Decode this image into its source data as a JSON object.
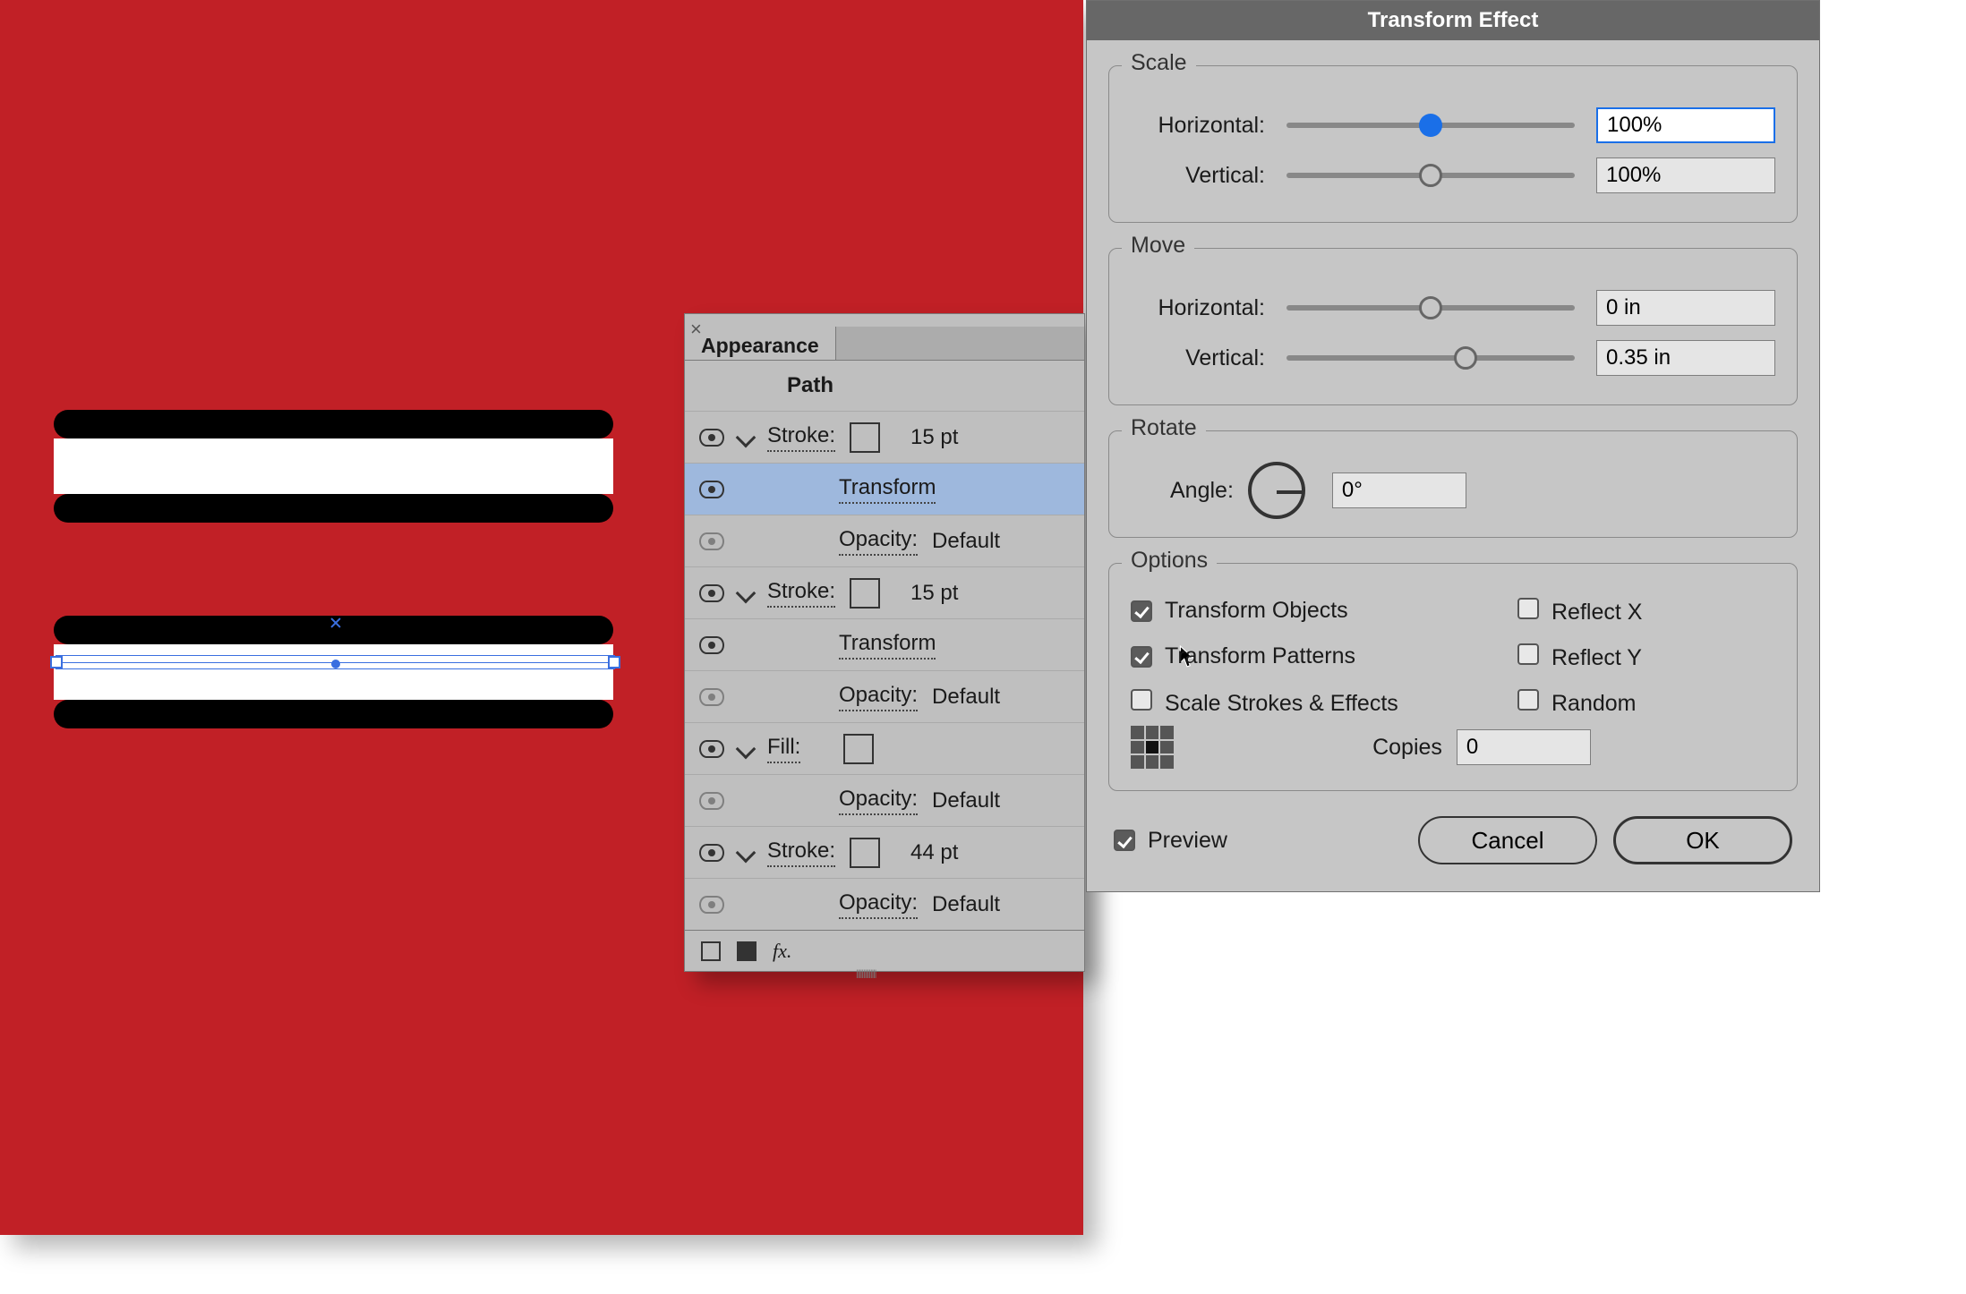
{
  "appearance": {
    "tab_label": "Appearance",
    "header": "Path",
    "rows": [
      {
        "kind": "stroke",
        "label": "Stroke:",
        "value": "15 pt",
        "swatch": "black"
      },
      {
        "kind": "fx",
        "label": "Transform",
        "selected": true
      },
      {
        "kind": "opacity",
        "label": "Opacity:",
        "value": "Default"
      },
      {
        "kind": "stroke",
        "label": "Stroke:",
        "value": "15 pt",
        "swatch": "black"
      },
      {
        "kind": "fx",
        "label": "Transform"
      },
      {
        "kind": "opacity",
        "label": "Opacity:",
        "value": "Default"
      },
      {
        "kind": "fill",
        "label": "Fill:",
        "swatch": "none"
      },
      {
        "kind": "opacity",
        "label": "Opacity:",
        "value": "Default"
      },
      {
        "kind": "stroke",
        "label": "Stroke:",
        "value": "44 pt",
        "swatch": "white"
      },
      {
        "kind": "opacity",
        "label": "Opacity:",
        "value": "Default"
      }
    ],
    "fx_label": "fx."
  },
  "dialog": {
    "title": "Transform Effect",
    "scale": {
      "legend": "Scale",
      "h_label": "Horizontal:",
      "h_value": "100%",
      "h_slider_pct": 50,
      "v_label": "Vertical:",
      "v_value": "100%",
      "v_slider_pct": 50
    },
    "move": {
      "legend": "Move",
      "h_label": "Horizontal:",
      "h_value": "0 in",
      "h_slider_pct": 50,
      "v_label": "Vertical:",
      "v_value": "0.35 in",
      "v_slider_pct": 62
    },
    "rotate": {
      "legend": "Rotate",
      "angle_label": "Angle:",
      "angle_value": "0°"
    },
    "options": {
      "legend": "Options",
      "transform_objects": "Transform Objects",
      "transform_patterns": "Transform Patterns",
      "scale_strokes": "Scale Strokes & Effects",
      "reflect_x": "Reflect X",
      "reflect_y": "Reflect Y",
      "random": "Random",
      "copies_label": "Copies",
      "copies_value": "0"
    },
    "preview_label": "Preview",
    "cancel": "Cancel",
    "ok": "OK"
  }
}
